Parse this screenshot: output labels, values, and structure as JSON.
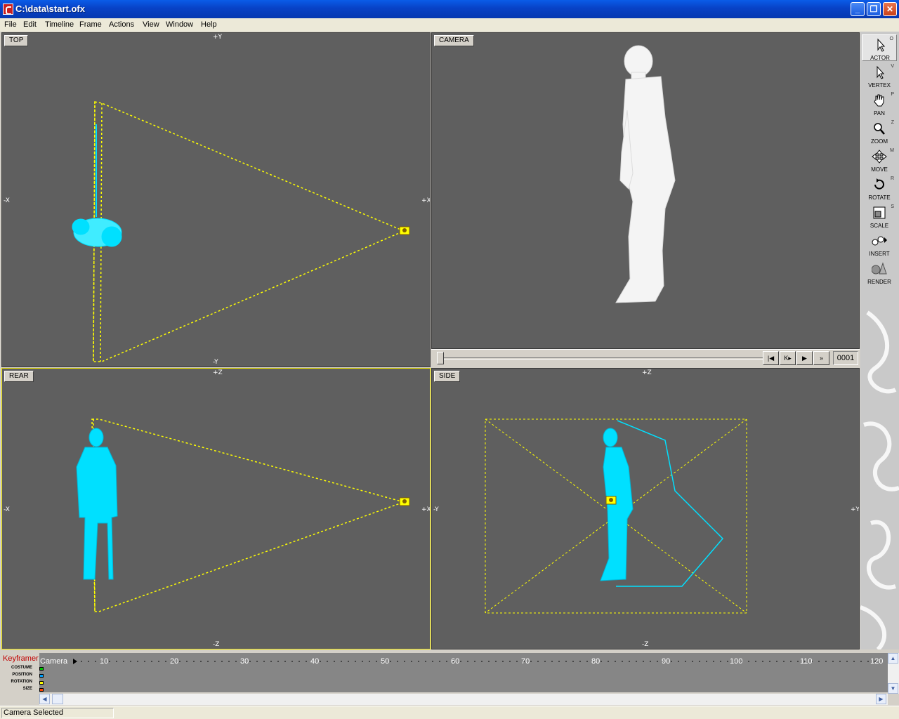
{
  "window": {
    "title": "C:\\data\\start.ofx",
    "minimize": "_",
    "maximize": "❐",
    "close": "✕"
  },
  "menu": [
    "File",
    "Edit",
    "Timeline",
    "Frame",
    "Actions",
    "View",
    "Window",
    "Help"
  ],
  "viewports": {
    "top": {
      "label": "TOP",
      "axis_top": "+Y",
      "axis_bottom": "-Y",
      "axis_left": "-X",
      "axis_right": "+X"
    },
    "camera": {
      "label": "CAMERA"
    },
    "rear": {
      "label": "REAR",
      "axis_top": "+Z",
      "axis_bottom": "-Z",
      "axis_left": "-X",
      "axis_right": "+X"
    },
    "side": {
      "label": "SIDE",
      "axis_top": "+Z",
      "axis_bottom": "-Z",
      "axis_left": "-Y",
      "axis_right": "+Y"
    }
  },
  "playback": {
    "frame": "0001",
    "buttons": [
      "|◀",
      "K▸",
      "▶",
      "»"
    ]
  },
  "tools": [
    {
      "label": "ACTOR",
      "hotkey": "O",
      "icon": "arrow-cursor-icon",
      "selected": true
    },
    {
      "label": "VERTEX",
      "hotkey": "V",
      "icon": "vertex-cursor-icon"
    },
    {
      "label": "PAN",
      "hotkey": "P",
      "icon": "hand-icon"
    },
    {
      "label": "ZOOM",
      "hotkey": "Z",
      "icon": "magnifier-icon"
    },
    {
      "label": "MOVE",
      "hotkey": "M",
      "icon": "move-arrows-icon"
    },
    {
      "label": "ROTATE",
      "hotkey": "R",
      "icon": "rotate-icon"
    },
    {
      "label": "SCALE",
      "hotkey": "S",
      "icon": "scale-icon"
    },
    {
      "label": "INSERT",
      "hotkey": "",
      "icon": "insert-shapes-icon"
    },
    {
      "label": "RENDER",
      "hotkey": "",
      "icon": "render-shapes-icon"
    }
  ],
  "keyframer": {
    "title": "Keyframer",
    "rows": [
      {
        "label": "COSTUME",
        "color": "#00c000"
      },
      {
        "label": "POSITION",
        "color": "#00a0ff"
      },
      {
        "label": "ROTATION",
        "color": "#ffff00"
      },
      {
        "label": "SIZE",
        "color": "#ff4000"
      }
    ],
    "track_name": "Camera",
    "ticks": [
      "10",
      "20",
      "30",
      "40",
      "50",
      "60",
      "70",
      "80",
      "90",
      "100",
      "110",
      "120"
    ]
  },
  "status": {
    "text": "Camera Selected"
  }
}
